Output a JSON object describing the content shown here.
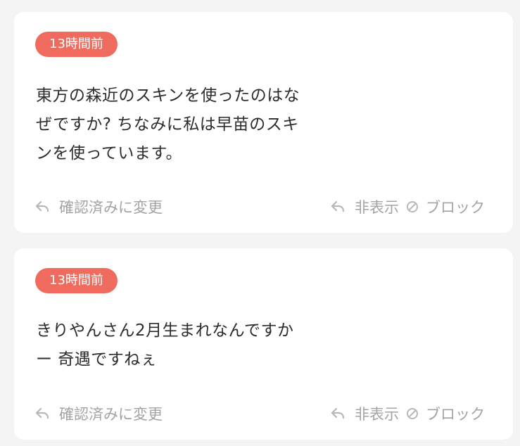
{
  "cards": [
    {
      "time_badge": "13時間前",
      "question_lines": [
        "東方の森近のスキンを使ったのはな",
        "ぜですか? ちなみに私は早苗のスキ",
        "ンを使っています。"
      ],
      "actions": {
        "mark_confirmed": "確認済みに変更",
        "hide": "非表示",
        "block": "ブロック"
      }
    },
    {
      "time_badge": "13時間前",
      "question_lines": [
        "きりやんさん2月生まれなんですか",
        "ー 奇遇ですねぇ"
      ],
      "actions": {
        "mark_confirmed": "確認済みに変更",
        "hide": "非表示",
        "block": "ブロック"
      }
    }
  ],
  "icons": {
    "reply": "reply-arrow-icon",
    "block": "prohibited-circle-icon"
  },
  "colors": {
    "badge_background": "#ee6b5e",
    "badge_text": "#ffffff",
    "question_text": "#2c2c2c",
    "action_text": "#a3a3a3",
    "card_background": "#ffffff",
    "page_background": "#f4f4f4"
  }
}
